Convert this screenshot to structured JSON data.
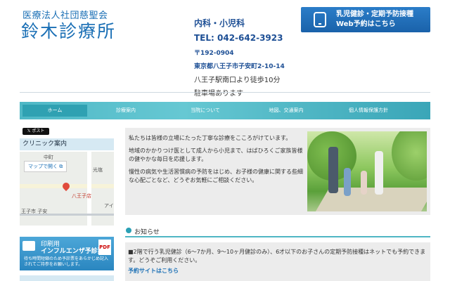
{
  "header": {
    "clinic_sub": "医療法人社団慈聖会",
    "clinic_name": "鈴木診療所",
    "departments": "内科・小児科",
    "tel": "TEL: 042-642-3923",
    "zip": "〒192-0904",
    "address": "東京都八王子市子安町2-10-14",
    "access": "八王子駅南口より徒歩10分",
    "parking": "駐車場あります",
    "banner_line1": "乳児健診・定期予防接種",
    "banner_line2": "Web予約はこちら"
  },
  "nav": {
    "items": [
      "ホーム",
      "診療案内",
      "当院について",
      "地図、交通案内",
      "個人情報保護方針"
    ],
    "active_index": 0
  },
  "sidebar": {
    "tweet_label": "ポスト",
    "clinic_info_title": "クリニック案内",
    "map_button": "マップで開く",
    "map_labels": [
      "中町",
      "光塩",
      "八王子店",
      "王子市 子安",
      "アイ"
    ],
    "pdf_line1": "印刷用",
    "pdf_line2": "インフルエンザ予診票",
    "pdf_line3": "待ち時間短縮のため予診票をあらかじめ記入されてご持参をお願いします。",
    "pdf_icon": "PDF"
  },
  "main": {
    "intro": [
      "私たちは皆様の立場にたった丁寧な診療をこころがけています。",
      "地域のかかりつけ医として成人から小児まで、はばひろくご家族皆様の健やかな毎日を応援します。",
      "慢性の病気や生活習慣病の予防をはじめ、お子様の健康に関する些細な心配ごとなど、どうぞお気軽にご相談ください。"
    ],
    "news_title": "お知らせ",
    "news_body": "■2階で行う乳児健診（6～7か月、9～10ヶ月健診のみ）、6才以下のお子さんの定期予防接種はネットでも予約できます。どうぞご利用ください。",
    "news_link": "予約サイトはこちら"
  },
  "colors": {
    "brand_blue": "#1a6fb5",
    "nav_teal": "#4fb6c4",
    "banner_blue": "#1a62aa"
  }
}
